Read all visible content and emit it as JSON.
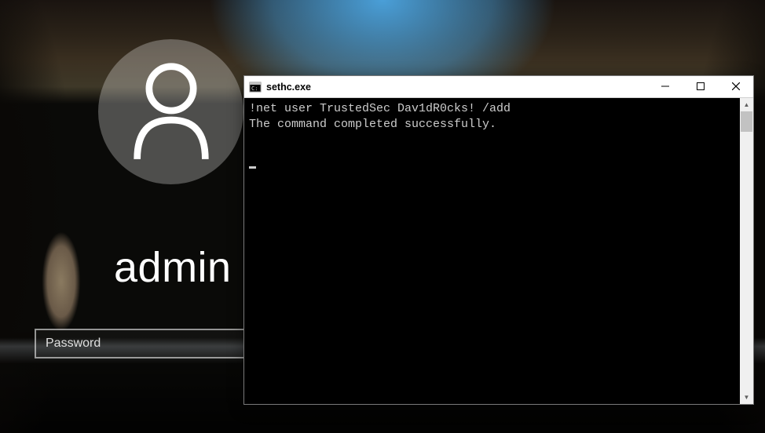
{
  "login": {
    "username": "admin",
    "password_placeholder": "Password",
    "password_value": ""
  },
  "console": {
    "title": "sethc.exe",
    "lines": [
      "!net user TrustedSec Dav1dR0cks! /add",
      "The command completed successfully.",
      ""
    ],
    "icons": {
      "app": "console-icon",
      "minimize": "minimize-icon",
      "maximize": "maximize-icon",
      "close": "close-icon"
    }
  },
  "colors": {
    "console_bg": "#000000",
    "console_fg": "#cccccc",
    "titlebar_bg": "#ffffff"
  }
}
